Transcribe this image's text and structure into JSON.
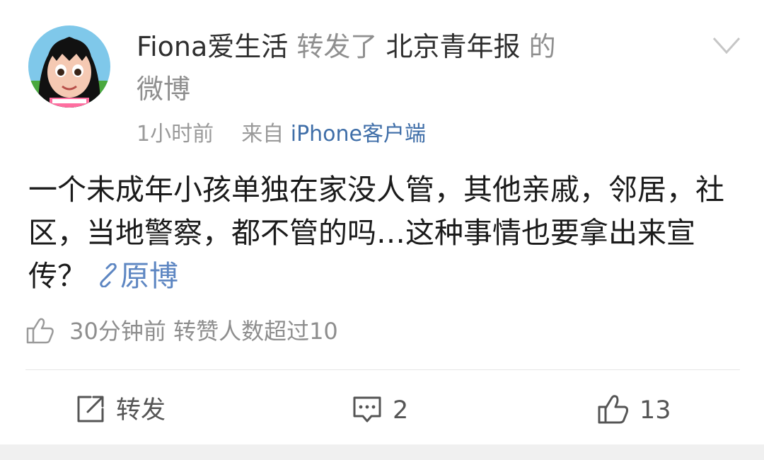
{
  "post": {
    "author": "Fiona爱生活",
    "action_text": "转发了",
    "source_account": "北京青年报",
    "of_text": "的",
    "weibo_text": "微博",
    "time": "1小时前",
    "from_label": "来自",
    "client": "iPhone客户端",
    "body_text": "一个未成年小孩单独在家没人管，其他亲戚，邻居，社区，当地警察，都不管的吗…这种事情也要拿出来宣传？",
    "original_link_label": "原博",
    "forward_info": "30分钟前 转赞人数超过10"
  },
  "actions": {
    "repost_label": "转发",
    "comment_count": "2",
    "like_count": "13"
  },
  "icons": {
    "dropdown": "chevron-down-icon",
    "link": "link-icon",
    "thumb": "thumbs-up-icon",
    "repost": "repost-icon",
    "comment": "comment-icon"
  }
}
